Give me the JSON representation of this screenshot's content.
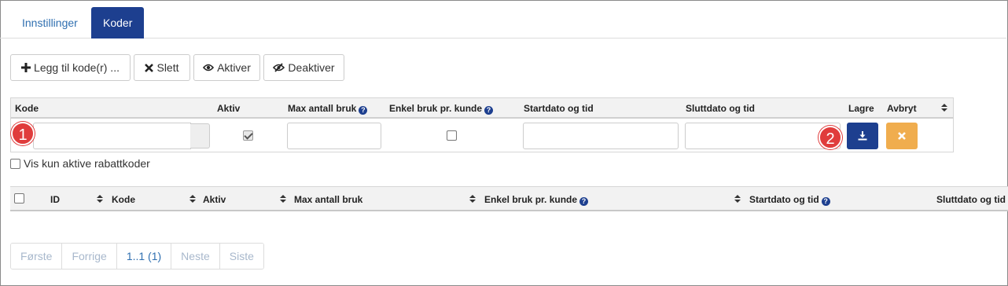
{
  "tabs": [
    {
      "label": "Innstillinger",
      "active": false
    },
    {
      "label": "Koder",
      "active": true
    }
  ],
  "toolbar": {
    "add_label": "Legg til kode(r) ...",
    "delete_label": "Slett",
    "activate_label": "Aktiver",
    "deactivate_label": "Deaktiver"
  },
  "edit_table": {
    "headers": {
      "code": "Kode",
      "active": "Aktiv",
      "max_use": "Max antall bruk",
      "single_use": "Enkel bruk pr. kunde",
      "start": "Startdato og tid",
      "end": "Sluttdato og tid",
      "save": "Lagre",
      "cancel": "Avbryt"
    },
    "row": {
      "code": "",
      "active": true,
      "max_use": "",
      "single_use": false,
      "start": "",
      "end": ""
    }
  },
  "badges": [
    "1",
    "2"
  ],
  "filter": {
    "only_active_label": "Vis kun aktive rabattkoder",
    "checked": false
  },
  "list_table": {
    "headers": {
      "id": "ID",
      "code": "Kode",
      "active": "Aktiv",
      "max_use": "Max antall bruk",
      "single_use": "Enkel bruk pr. kunde",
      "start": "Startdato og tid",
      "end": "Sluttdato og tid"
    }
  },
  "pagination": {
    "first": "Første",
    "prev": "Forrige",
    "current": "1..1 (1)",
    "next": "Neste",
    "last": "Siste"
  },
  "colors": {
    "primary": "#1d3f8f",
    "warning": "#f0ad4e",
    "badge": "#e03c3c",
    "link": "#2f6fb0"
  }
}
